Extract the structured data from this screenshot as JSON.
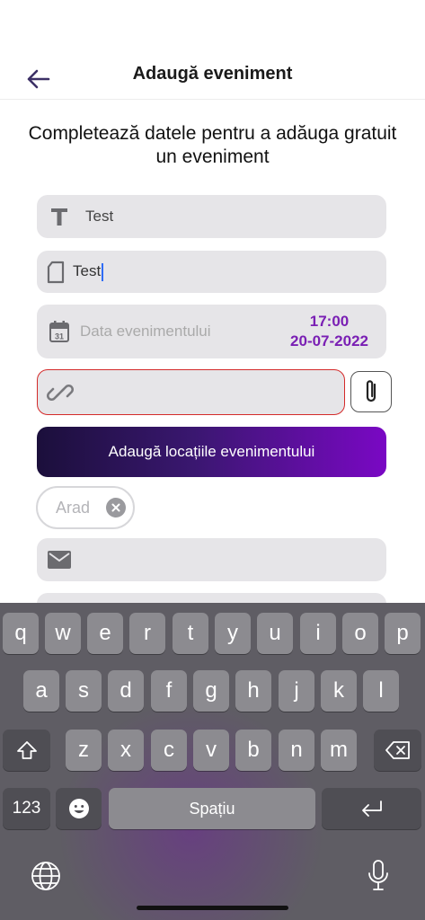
{
  "header": {
    "title": "Adaugă eveniment"
  },
  "subtitle": "Completează datele pentru a adăuga gratuit un eveniment",
  "form": {
    "title_value": "Test",
    "description_value": "Test",
    "date_placeholder": "Data evenimentului",
    "time": "17:00",
    "date": "20-07-2022",
    "link_value": "",
    "locations_button": "Adaugă locațiile evenimentului",
    "location_chip": "Arad",
    "email_value": ""
  },
  "colors": {
    "accent": "#7a1fb4",
    "error_border": "#d42a2a",
    "field_bg": "#e6e5e8"
  },
  "keyboard": {
    "row1": [
      "q",
      "w",
      "e",
      "r",
      "t",
      "y",
      "u",
      "i",
      "o",
      "p"
    ],
    "row2": [
      "a",
      "s",
      "d",
      "f",
      "g",
      "h",
      "j",
      "k",
      "l"
    ],
    "row3": [
      "z",
      "x",
      "c",
      "v",
      "b",
      "n",
      "m"
    ],
    "numbers_key": "123",
    "space_key": "Spațiu"
  }
}
